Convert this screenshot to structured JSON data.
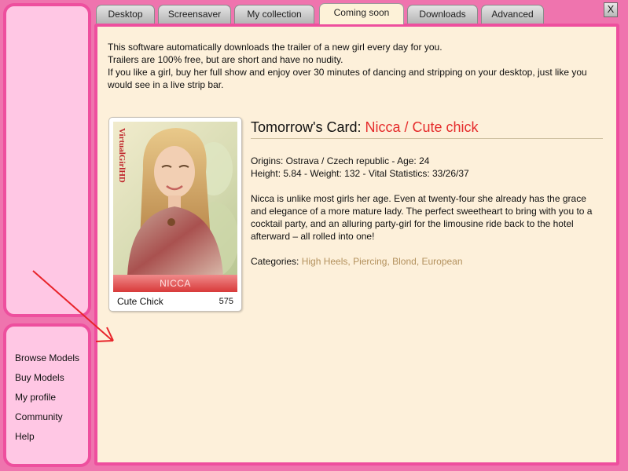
{
  "sidebar": {
    "nav_items": [
      "Browse Models",
      "Buy Models",
      "My profile",
      "Community",
      "Help"
    ]
  },
  "tabs": [
    {
      "label": "Desktop",
      "active": false
    },
    {
      "label": "Screensaver",
      "active": false
    },
    {
      "label": "My collection",
      "active": false
    },
    {
      "label": "Coming soon",
      "active": true
    },
    {
      "label": "Downloads",
      "active": false
    },
    {
      "label": "Advanced",
      "active": false
    }
  ],
  "close_glyph": "X",
  "intro": {
    "line1": "This software automatically downloads the trailer of a new girl every day for you.",
    "line2": "Trailers are 100% free, but are short and have no nudity.",
    "line3": "If you like a girl, buy her full show and enjoy over 30 minutes of dancing and stripping on your desktop, just like you would see in a live strip bar."
  },
  "card": {
    "brand": "VirtualGirlHD",
    "name": "NICCA",
    "title": "Cute Chick",
    "number": "575"
  },
  "details": {
    "heading_prefix": "Tomorrow's Card: ",
    "heading_model": "Nicca / Cute chick",
    "origins": "Origins: Ostrava / Czech republic - Age: 24",
    "stats": "Height: 5.84 - Weight: 132 - Vital Statistics: 33/26/37",
    "description": "Nicca is unlike most girls her age. Even at twenty-four she already has the grace and elegance of a more mature lady. The perfect sweetheart to bring with you to a cocktail party, and an alluring party-girl for the limousine ride back to the hotel afterward – all rolled into one!",
    "categories_label": "Categories: ",
    "categories": [
      "High Heels",
      "Piercing",
      "Blond",
      "European"
    ]
  },
  "colors": {
    "frame_pink": "#ee4f9e",
    "panel_cream": "#fdf0da",
    "category_link": "#b3915d",
    "heading_red": "#e52b2b",
    "annotation_arrow": "#e8232a"
  }
}
